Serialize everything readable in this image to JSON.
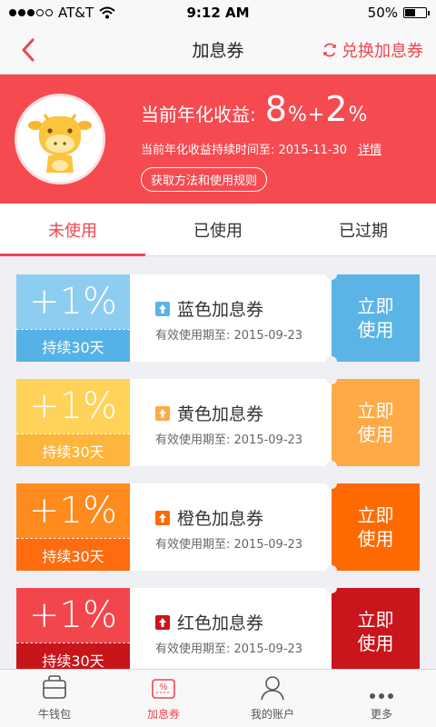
{
  "status_bar": {
    "carrier": "AT&T",
    "time": "9:12 AM",
    "battery": "50%",
    "battery_level": 0.5
  },
  "nav": {
    "title": "加息券",
    "action_label": "兑换加息券",
    "back_icon": "chevron-left-icon",
    "action_icon": "refresh-icon"
  },
  "hero": {
    "rate_label": "当前年化收益:",
    "rate_base": "8",
    "rate_plus": "+",
    "rate_extra": "2",
    "percent": "%",
    "time_label": "当前年化收益持续时间至: 2015-11-30",
    "detail_link": "详情",
    "rule_button": "获取方法和使用规则",
    "avatar_icon": "cow-mascot-icon"
  },
  "tabs": [
    {
      "label": "未使用",
      "active": true
    },
    {
      "label": "已使用",
      "active": false
    },
    {
      "label": "已过期",
      "active": false
    }
  ],
  "coupons": [
    {
      "rate": "+1%",
      "duration": "持续30天",
      "name": "蓝色加息券",
      "valid": "有效使用期至: 2015-09-23",
      "button": "立即使用",
      "top_color": "#8dcdf0",
      "bottom_color": "#55b2e6",
      "btn_color": "#5bb4e5"
    },
    {
      "rate": "+1%",
      "duration": "持续30天",
      "name": "黄色加息券",
      "valid": "有效使用期至: 2015-09-23",
      "button": "立即使用",
      "top_color": "#ffd25a",
      "bottom_color": "#fdb53c",
      "btn_color": "#fdaa47"
    },
    {
      "rate": "+1%",
      "duration": "持续30天",
      "name": "橙色加息券",
      "valid": "有效使用期至: 2015-09-23",
      "button": "立即使用",
      "top_color": "#ff8a1d",
      "bottom_color": "#ff6b0f",
      "btn_color": "#ff6a00"
    },
    {
      "rate": "+1%",
      "duration": "持续30天",
      "name": "红色加息券",
      "valid": "有效使用期至: 2015-09-23",
      "button": "立即使用",
      "top_color": "#f3464c",
      "bottom_color": "#c8151a",
      "btn_color": "#c9151b"
    }
  ],
  "tabbar": [
    {
      "label": "牛钱包",
      "icon": "wallet-icon",
      "active": false
    },
    {
      "label": "加息券",
      "icon": "coupon-icon",
      "active": true
    },
    {
      "label": "我的账户",
      "icon": "user-icon",
      "active": false
    },
    {
      "label": "更多",
      "icon": "more-icon",
      "active": false
    }
  ],
  "colors": {
    "accent": "#f0454f",
    "hero_bg": "#f64a51"
  }
}
